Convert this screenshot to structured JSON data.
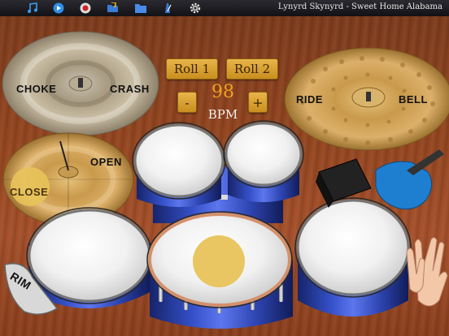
{
  "toolbar": {
    "icons": [
      "music-note-icon",
      "play-icon",
      "record-icon",
      "folder-open-icon",
      "folder-icon",
      "metronome-icon",
      "settings-gear-icon"
    ],
    "song_title": "Lynyrd Skynyrd - Sweet Home Alabama"
  },
  "cymbals": {
    "crash_left_label": "CHOKE",
    "crash_right_label": "CRASH",
    "ride_left_label": "RIDE",
    "ride_right_label": "BELL",
    "hihat_open_label": "OPEN",
    "hihat_close_label": "CLOSE"
  },
  "controls": {
    "roll1_label": "Roll 1",
    "roll2_label": "Roll 2",
    "minus_label": "-",
    "plus_label": "+",
    "bpm_value": "98",
    "bpm_label": "BPM"
  },
  "pads": {
    "rim_label": "RIM"
  },
  "colors": {
    "accent": "#f0a020",
    "button": "#d9a235",
    "drum_shell": "#3a54d0",
    "cowbell": "#1e7fd0"
  }
}
